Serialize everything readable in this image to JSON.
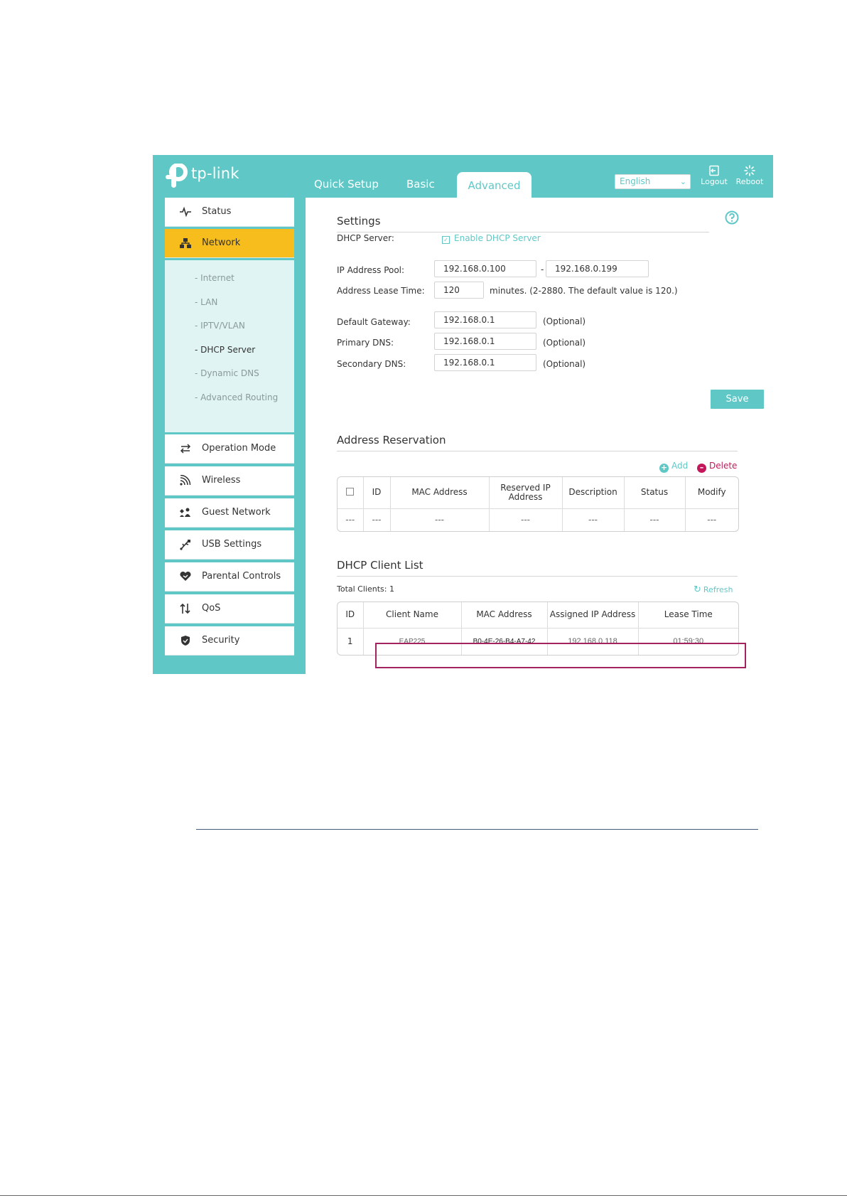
{
  "header": {
    "logo_text": "tp-link",
    "tabs": [
      {
        "label": "Quick Setup"
      },
      {
        "label": "Basic"
      },
      {
        "label": "Advanced"
      }
    ],
    "language": "English",
    "logout_label": "Logout",
    "reboot_label": "Reboot"
  },
  "sidebar": {
    "items": [
      {
        "label": "Status",
        "icon": "pulse-icon"
      },
      {
        "label": "Network",
        "icon": "network-icon"
      },
      {
        "label": "Operation Mode",
        "icon": "swap-icon"
      },
      {
        "label": "Wireless",
        "icon": "wifi-icon"
      },
      {
        "label": "Guest Network",
        "icon": "guests-icon"
      },
      {
        "label": "USB Settings",
        "icon": "usb-icon"
      },
      {
        "label": "Parental Controls",
        "icon": "heart-icon"
      },
      {
        "label": "QoS",
        "icon": "updown-arrows-icon"
      },
      {
        "label": "Security",
        "icon": "shield-icon"
      }
    ],
    "network_sub": [
      {
        "label": "- Internet"
      },
      {
        "label": "- LAN"
      },
      {
        "label": "- IPTV/VLAN"
      },
      {
        "label": "- DHCP Server"
      },
      {
        "label": "- Dynamic DNS"
      },
      {
        "label": "- Advanced Routing"
      }
    ]
  },
  "settings": {
    "title": "Settings",
    "dhcp_server_label": "DHCP Server:",
    "enable_label": "Enable DHCP Server",
    "enable_checked": true,
    "ip_pool_label": "IP Address Pool:",
    "ip_pool_start": "192.168.0.100",
    "ip_pool_sep": "-",
    "ip_pool_end": "192.168.0.199",
    "lease_label": "Address Lease Time:",
    "lease_value": "120",
    "lease_note": "minutes. (2-2880. The default value is 120.)",
    "gateway_label": "Default Gateway:",
    "gateway_value": "192.168.0.1",
    "primary_dns_label": "Primary DNS:",
    "primary_dns_value": "192.168.0.1",
    "secondary_dns_label": "Secondary DNS:",
    "secondary_dns_value": "192.168.0.1",
    "optional": "(Optional)",
    "save_label": "Save"
  },
  "reservation": {
    "title": "Address Reservation",
    "add_label": "Add",
    "delete_label": "Delete",
    "columns": [
      "ID",
      "MAC Address",
      "Reserved IP Address",
      "Description",
      "Status",
      "Modify"
    ],
    "empty_row": [
      "---",
      "---",
      "---",
      "---",
      "---",
      "---",
      "---"
    ]
  },
  "client_list": {
    "title": "DHCP Client List",
    "total_label": "Total Clients: 1",
    "refresh_label": "Refresh",
    "columns": [
      "ID",
      "Client Name",
      "MAC Address",
      "Assigned IP Address",
      "Lease Time"
    ],
    "rows": [
      [
        "1",
        "EAP225",
        "B0-4E-26-B4-A7-42",
        "192.168.0.118",
        "01:59:30"
      ]
    ]
  },
  "colors": {
    "brand_teal": "#5fc8c6",
    "active_menu": "#f6bd1c",
    "highlight_box": "#a3235f",
    "delete_red": "#c2185b"
  }
}
